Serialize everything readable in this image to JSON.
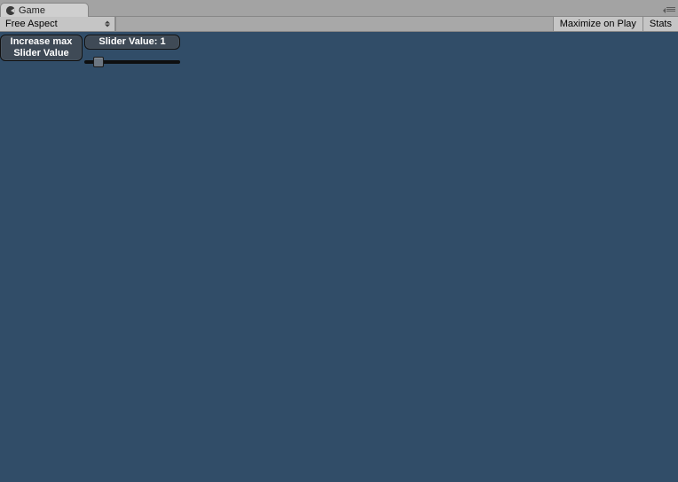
{
  "tab": {
    "label": "Game",
    "icon": "pacman-icon"
  },
  "toolbar": {
    "aspect_label": "Free Aspect",
    "maximize_label": "Maximize on Play",
    "stats_label": "Stats"
  },
  "game_ui": {
    "increase_button_label": "Increase max Slider Value",
    "slider_value_label": "Slider Value: 1",
    "slider": {
      "min": 0,
      "max": 100,
      "value": 10
    }
  },
  "colors": {
    "viewport_bg": "#314d68",
    "editor_bg": "#a3a3a3",
    "toolbar_bg": "#cfcfcf",
    "ui_button_bg": "#3f4a56"
  }
}
